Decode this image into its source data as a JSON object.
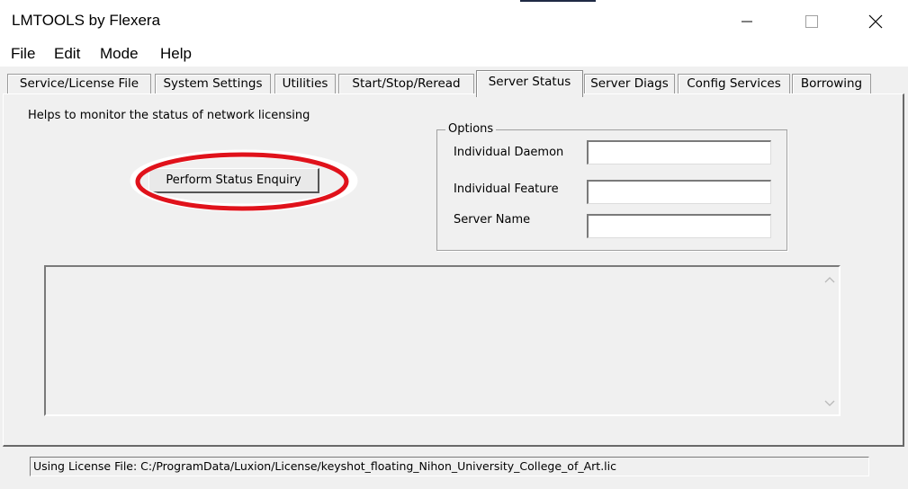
{
  "window": {
    "title": "LMTOOLS by Flexera"
  },
  "menu": {
    "items": [
      "File",
      "Edit",
      "Mode",
      "Help"
    ]
  },
  "tabs": [
    {
      "label": "Service/License File",
      "active": false
    },
    {
      "label": "System Settings",
      "active": false
    },
    {
      "label": "Utilities",
      "active": false
    },
    {
      "label": "Start/Stop/Reread",
      "active": false
    },
    {
      "label": "Server Status",
      "active": true
    },
    {
      "label": "Server Diags",
      "active": false
    },
    {
      "label": "Config Services",
      "active": false
    },
    {
      "label": "Borrowing",
      "active": false
    }
  ],
  "server_status": {
    "help_text": "Helps to monitor the status of network licensing",
    "enquiry_button": "Perform Status Enquiry",
    "options": {
      "title": "Options",
      "daemon_label": "Individual Daemon",
      "daemon_value": "",
      "feature_label": "Individual Feature",
      "feature_value": "",
      "server_label": "Server Name",
      "server_value": ""
    },
    "output_text": ""
  },
  "status_bar": {
    "text": "Using License File:  C:/ProgramData/Luxion/License/keyshot_floating_Nihon_University_College_of_Art.lic"
  },
  "annotation": {
    "ring_color": "#e0121b"
  },
  "icons": {
    "minimize": "minimize-icon",
    "maximize": "maximize-icon",
    "close": "close-icon",
    "scroll_up": "chevron-up-icon",
    "scroll_down": "chevron-down-icon"
  }
}
